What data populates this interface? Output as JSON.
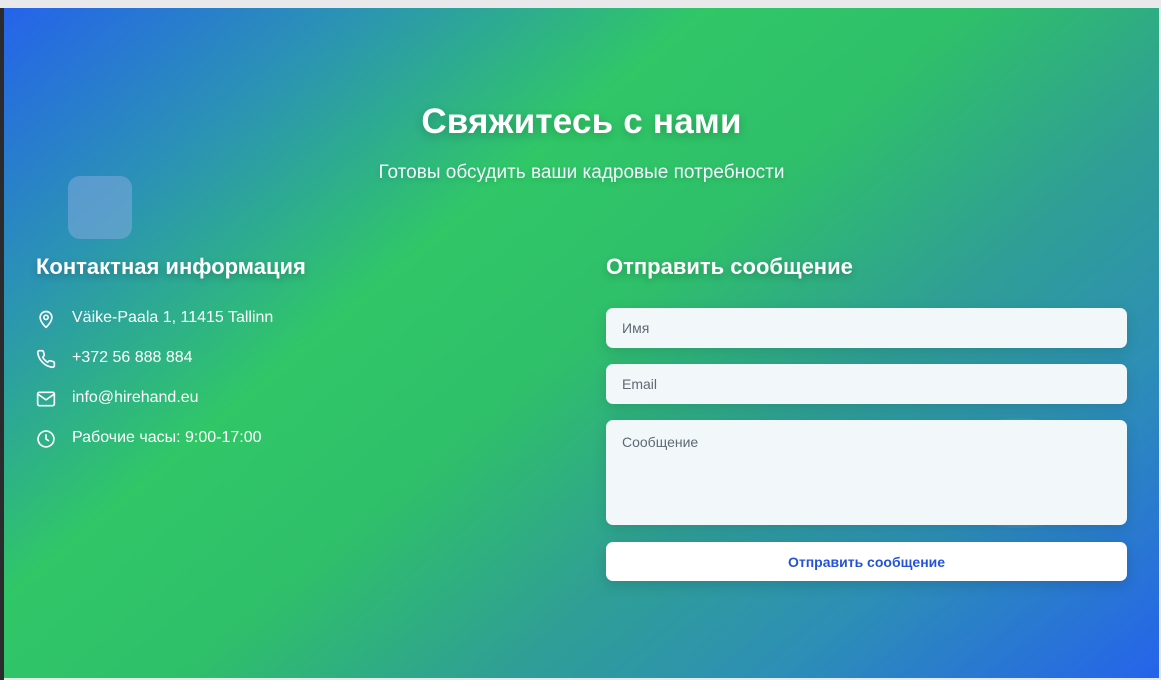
{
  "header": {
    "title": "Свяжитесь с нами",
    "subtitle": "Готовы обсудить ваши кадровые потребности"
  },
  "contact": {
    "title": "Контактная информация",
    "items": [
      {
        "icon": "map-pin-icon",
        "text": "Väike-Paala 1, 11415 Tallinn"
      },
      {
        "icon": "phone-icon",
        "text": "+372 56 888 884"
      },
      {
        "icon": "mail-icon",
        "text": "info@hirehand.eu"
      },
      {
        "icon": "clock-icon",
        "text": "Рабочие часы: 9:00-17:00"
      }
    ]
  },
  "form": {
    "title": "Отправить сообщение",
    "name_placeholder": "Имя",
    "email_placeholder": "Email",
    "message_placeholder": "Сообщение",
    "submit_label": "Отправить сообщение"
  },
  "colors": {
    "gradient_start": "#2563eb",
    "gradient_mid": "#30c767",
    "gradient_end": "#2563eb",
    "button_text": "#2553d8"
  }
}
